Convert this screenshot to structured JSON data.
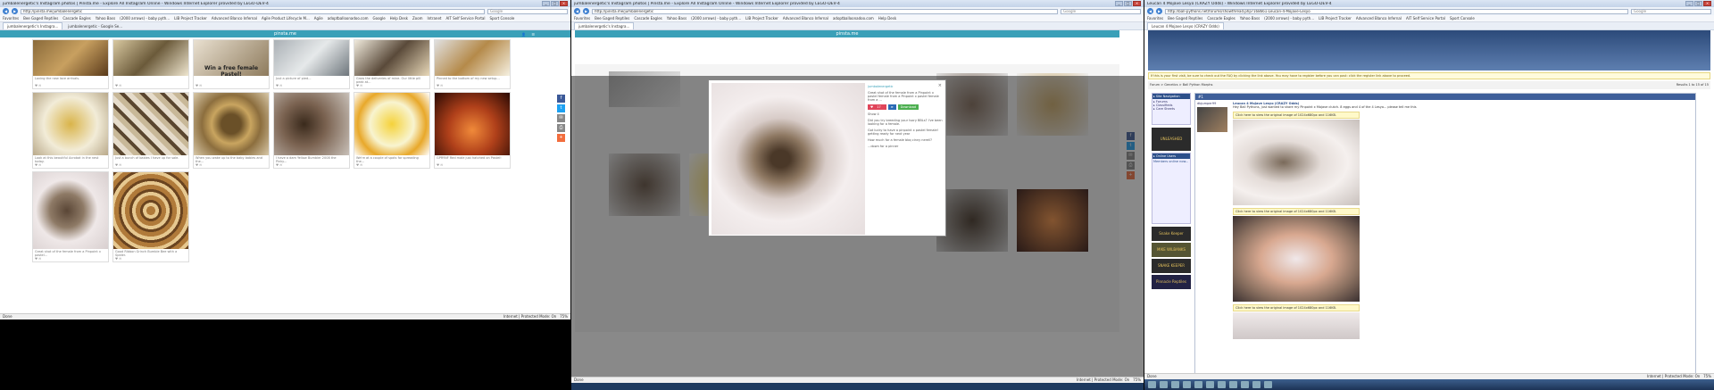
{
  "w1": {
    "title": "jumbalenergetic's Instagram photos | Pinsta.me - Explore All Instagram Online - Windows Internet Explorer provided by LEGO-DEV-4",
    "url": "http://pinsta.me/jumbalenergetic",
    "search": "Google",
    "favorites": [
      "Favorites",
      "Bee Gaged Reptiles",
      "Cascade Eagles",
      "Yahoo Bass",
      "(2000 arrows) - baby pyth...",
      "LIB Project Tracker",
      "Advanced Blanco Infernal",
      "Agile Product Lifecycle M...",
      "Agile",
      "adoptballoonadoo.com",
      "Google",
      "Help Desk",
      "Zoom",
      "Intranet",
      "AIT Self Service Portal",
      "Sport Console"
    ],
    "tabs": [
      "jumbalenergetic's Instagra...",
      "jumbalenergetic - Google Se..."
    ],
    "banner": "pinsta.me",
    "captions": [
      "Loving the new lace arrivals.",
      "",
      "Win a free female Pastel!",
      "Just a picture of pied...",
      "Grow the deliveries of mine. Our little pill peak at...",
      "Pinned to the bottom of my new setup...",
      "Look at this beautiful Acrobat in the nest today.",
      "Just a bunch of babies I have up for sale.",
      "When you wake up to the baby babies and the...",
      "I have a dam Yellow Bumbler 2008 the Pinky...",
      "We're at a couple of spots for spreading the...",
      "GPRYNF Red male just hatched on Pastel!",
      "Great shot of the female from a Pinpoint x pastel...",
      "Good Ribbon Grinch Bumble Bee with a Spider."
    ],
    "status_left": "Done",
    "status_right": "Internet | Protected Mode: On",
    "zoom": "75%"
  },
  "w2": {
    "title": "jumbalenergetic's Instagram photos | Pinsta.me - Explore All Instagram Online - Windows Internet Explorer provided by LEGO-DEV-4",
    "url": "http://pinsta.me/jumbalenergetic",
    "search": "Google",
    "banner": "pinsta.me",
    "modal_user": "jumbalenergetic",
    "modal_text": "Great shot of the female from a Pinpoint x pastel female from a Pinpoint x pastel female from a ...",
    "btn_like": "17",
    "btn_share": "Download",
    "comment_count": "Show 4",
    "comments": [
      "Did you try breeding your Ivory BBLs? I've been looking for a female.",
      "Got lucky to have a pinpoint x pastel female! getting ready for next year",
      "How much for a female bbq cinny nerell?",
      "...down for a pinner"
    ],
    "status_right": "Internet | Protected Mode: On",
    "zoom": "75%"
  },
  "w3": {
    "title": "Leucan 4 Mojave Lesyo (CRAZY Odds) - Windows Internet Explorer provided by LEGO-DEV-4",
    "url": "http://ball-pythons.net/forums/showthread.php?168661-Leucan-4-Mojave-Lesyo",
    "search": "Google",
    "notice": "If this is your first visit, be sure to check out the FAQ by clicking the link above. You may have to register before you can post: click the register link above to proceed.",
    "nav_left": "Forum > Genetics > Ball Python Morphs",
    "nav_right": "Results 1 to 15 of 15",
    "post_title": "Leucan 4 Mojave Lesyo (CRAZY Odds)",
    "poster": "dbjumper99",
    "post_intro": "Hey Ball Pythons, just wanted to share my Pinpoint x Mojave clutch. 8 eggs and 4 of the 4 Lesyo... please tell me this",
    "img_note": "Click here to view the original image of 1024x680px and 116KB.",
    "ad_titles": [
      "UNLEASHED",
      "Snake Keeper",
      "MIKE WILBANKS",
      "SNAKE KEEPER",
      "Pinnacle Reptiles"
    ],
    "status_right": "Internet | Protected Mode: On",
    "zoom": "75%"
  },
  "colors": {
    "pinsta": "#3aa0b8",
    "facebook": "#3b5998",
    "twitter": "#1da1f2",
    "email": "#888888",
    "share": "#f26d3d"
  }
}
